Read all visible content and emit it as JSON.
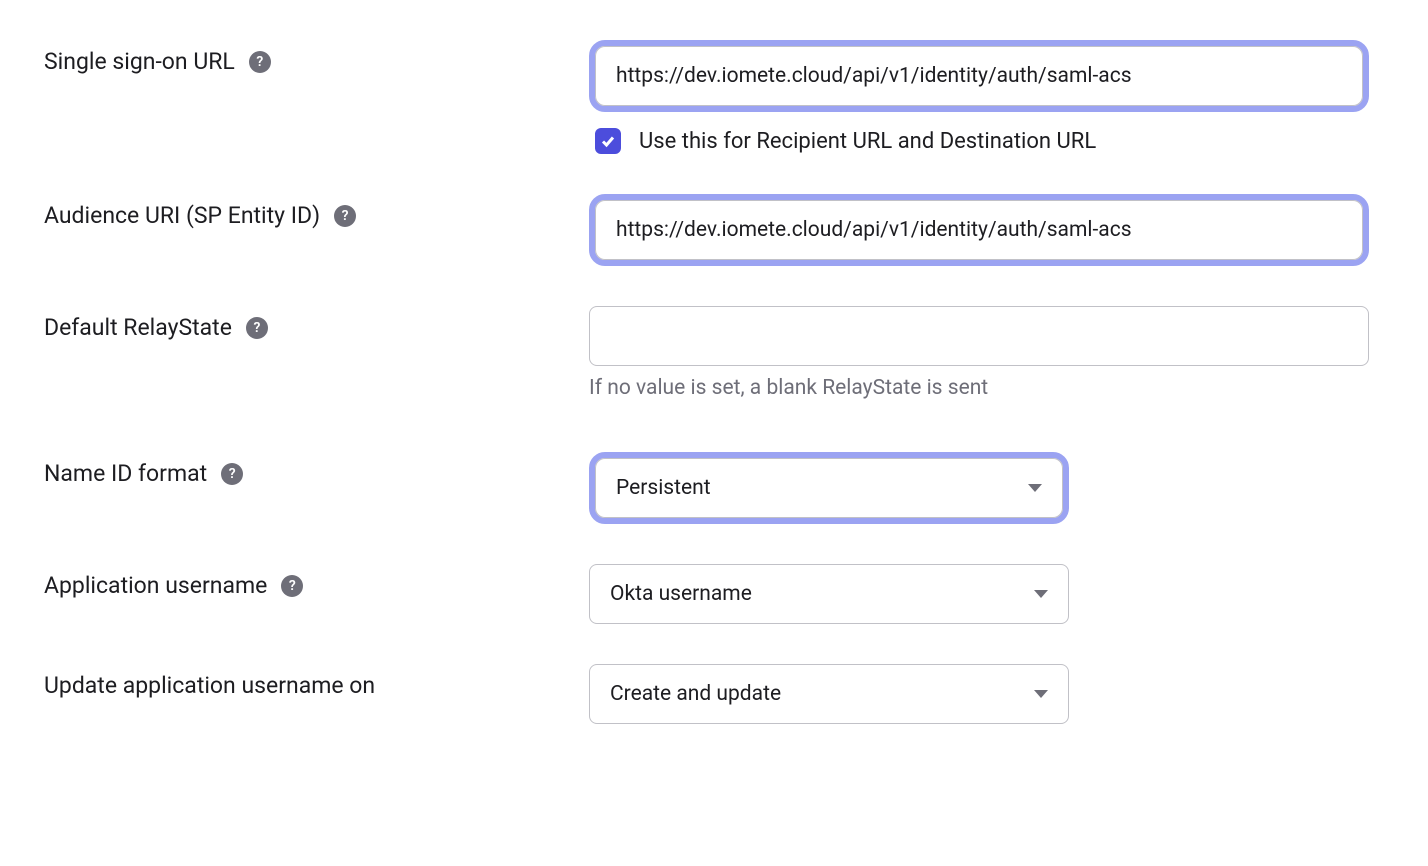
{
  "fields": {
    "sso_url": {
      "label": "Single sign-on URL",
      "value": "https://dev.iomete.cloud/api/v1/identity/auth/saml-acs",
      "checkbox_label": "Use this for Recipient URL and Destination URL",
      "checkbox_checked": true
    },
    "audience_uri": {
      "label": "Audience URI (SP Entity ID)",
      "value": "https://dev.iomete.cloud/api/v1/identity/auth/saml-acs"
    },
    "relay_state": {
      "label": "Default RelayState",
      "value": "",
      "hint": "If no value is set, a blank RelayState is sent"
    },
    "name_id_format": {
      "label": "Name ID format",
      "value": "Persistent"
    },
    "app_username": {
      "label": "Application username",
      "value": "Okta username"
    },
    "update_username_on": {
      "label": "Update application username on",
      "value": "Create and update"
    }
  }
}
